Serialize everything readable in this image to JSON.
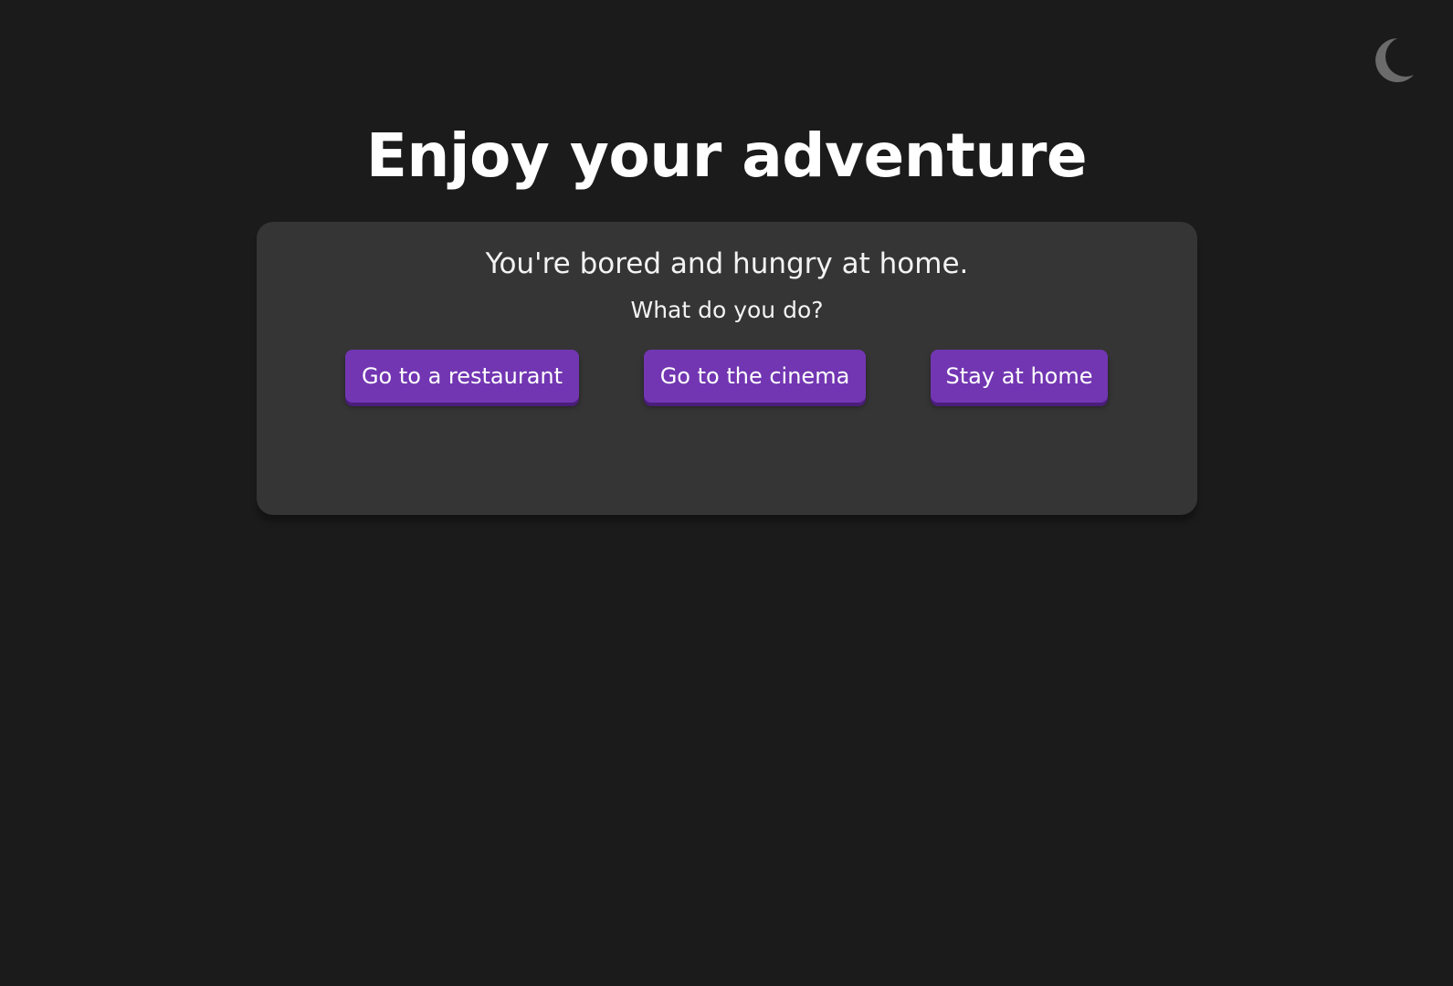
{
  "theme_toggle": {
    "icon": "moon-icon",
    "color": "#6b6b6b"
  },
  "header": {
    "title": "Enjoy your adventure"
  },
  "story": {
    "text": "You're bored and hungry at home.",
    "question": "What do you do?",
    "choices": [
      {
        "label": "Go to a restaurant"
      },
      {
        "label": "Go to the cinema"
      },
      {
        "label": "Stay at home"
      }
    ]
  },
  "colors": {
    "background": "#1b1b1b",
    "card": "#353535",
    "button": "#7236b2",
    "text": "#ffffff"
  }
}
